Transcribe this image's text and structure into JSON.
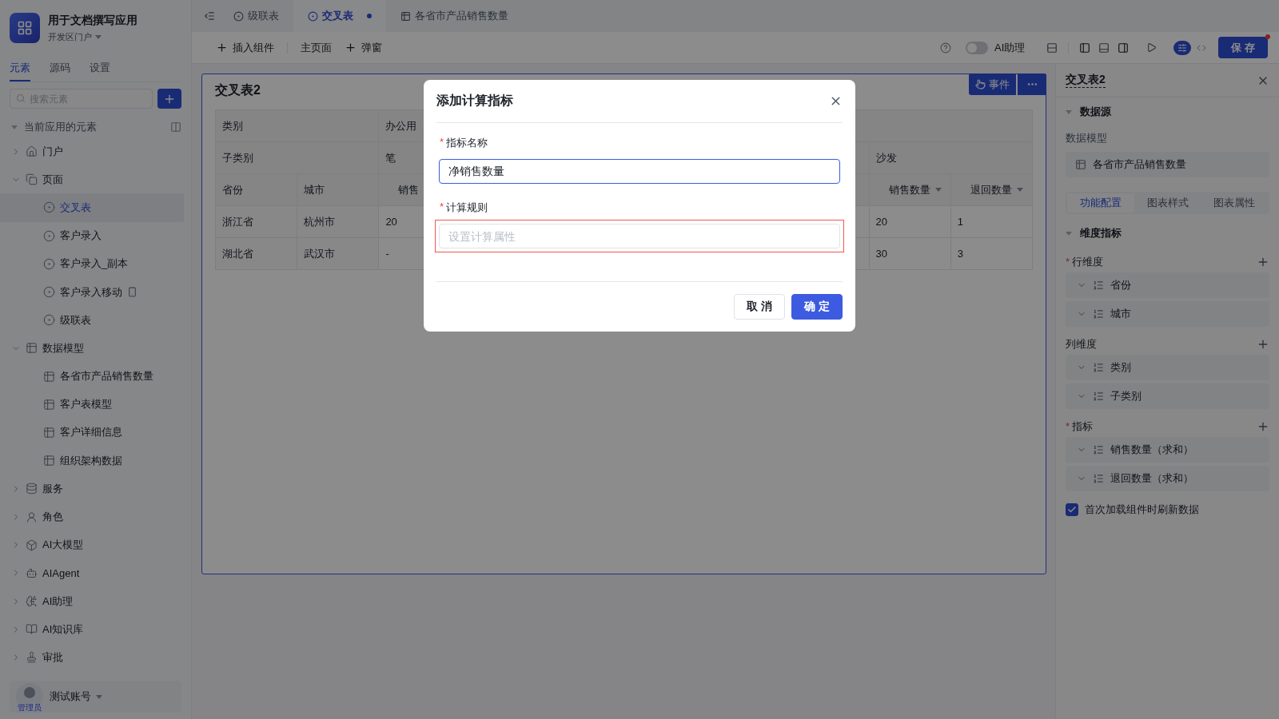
{
  "app": {
    "title": "用于文档撰写应用",
    "portal": "开发区门户"
  },
  "sidebar_tabs": [
    {
      "label": "元素",
      "selected": true
    },
    {
      "label": "源码",
      "selected": false
    },
    {
      "label": "设置",
      "selected": false
    }
  ],
  "search": {
    "placeholder": "搜索元素"
  },
  "tree": {
    "title": "当前应用的元素",
    "expanded": true,
    "items": [
      {
        "label": "门户",
        "kind": "home",
        "expanded": false
      },
      {
        "label": "页面",
        "kind": "pages",
        "expanded": true,
        "children": [
          {
            "label": "交叉表",
            "kind": "page",
            "selected": true
          },
          {
            "label": "客户录入",
            "kind": "page",
            "selected": false
          },
          {
            "label": "客户录入_副本",
            "kind": "page",
            "selected": false
          },
          {
            "label": "客户录入移动",
            "kind": "mobile_page",
            "selected": false
          },
          {
            "label": "级联表",
            "kind": "page",
            "selected": false
          }
        ]
      },
      {
        "label": "数据模型",
        "kind": "table",
        "expanded": true,
        "children": [
          {
            "label": "各省市产品销售数量",
            "kind": "table",
            "selected": false
          },
          {
            "label": "客户表模型",
            "kind": "table",
            "selected": false
          },
          {
            "label": "客户详细信息",
            "kind": "table",
            "selected": false
          },
          {
            "label": "组织架构数据",
            "kind": "table",
            "selected": false
          }
        ]
      },
      {
        "label": "服务",
        "kind": "service",
        "expanded": false
      },
      {
        "label": "角色",
        "kind": "role",
        "expanded": false
      },
      {
        "label": "AI大模型",
        "kind": "llm",
        "expanded": false
      },
      {
        "label": "AIAgent",
        "kind": "agent",
        "expanded": false
      },
      {
        "label": "AI助理",
        "kind": "assistant",
        "expanded": false
      },
      {
        "label": "AI知识库",
        "kind": "knowledge",
        "expanded": false
      },
      {
        "label": "审批",
        "kind": "approval",
        "expanded": false
      }
    ]
  },
  "user": {
    "name": "测试账号",
    "badge": "管理员"
  },
  "editor_tabs": [
    {
      "label": "级联表",
      "kind": "page",
      "selected": false,
      "modified": false
    },
    {
      "label": "交叉表",
      "kind": "page",
      "selected": true,
      "modified": true
    },
    {
      "label": "各省市产品销售数量",
      "kind": "table",
      "selected": false,
      "modified": false
    }
  ],
  "toolbar": {
    "left": [
      {
        "label": "插入组件",
        "kind": "add"
      },
      {
        "label": "主页面",
        "kind": "text"
      },
      {
        "label": "弹窗",
        "kind": "add"
      }
    ],
    "assistant": {
      "label": "AI助理",
      "on": false
    },
    "mode": [
      {
        "kind": "design",
        "selected": true
      },
      {
        "kind": "code",
        "selected": false
      }
    ],
    "save": {
      "label": "保 存",
      "unsaved": true
    }
  },
  "widget": {
    "title": "交叉表2",
    "event_button": "事件",
    "table": {
      "header_rows": [
        [
          {
            "text": "类别"
          },
          {
            "text": "办公用"
          },
          {}
        ],
        [
          {
            "text": "子类别"
          },
          {
            "text": "笔"
          },
          {},
          {},
          {
            "text": "沙发"
          }
        ],
        [
          {
            "text": "省份",
            "sortable": false
          },
          {
            "text": "城市",
            "sortable": false
          },
          {
            "text": "销售"
          },
          {},
          {},
          {},
          {},
          {},
          {
            "text": "销售数量",
            "sortable": true
          },
          {
            "text": "退回数量",
            "sortable": true
          }
        ]
      ],
      "rows": [
        [
          {
            "text": "浙江省"
          },
          {
            "text": "杭州市"
          },
          {
            "text": "20"
          },
          {},
          {},
          {},
          {},
          {},
          {
            "text": "20"
          },
          {
            "text": "1"
          }
        ],
        [
          {
            "text": "湖北省"
          },
          {
            "text": "武汉市"
          },
          {
            "text": "-"
          },
          {},
          {},
          {},
          {},
          {},
          {
            "text": "30"
          },
          {
            "text": "3"
          }
        ]
      ]
    }
  },
  "panel": {
    "title": "交叉表2",
    "datasource": {
      "title": "数据源",
      "expanded": true,
      "label": "数据模型",
      "model": "各省市产品销售数量"
    },
    "tabs": [
      {
        "label": "功能配置",
        "selected": true
      },
      {
        "label": "图表样式",
        "selected": false
      },
      {
        "label": "图表属性",
        "selected": false
      }
    ],
    "dimensions": {
      "title": "维度指标",
      "expanded": true,
      "groups": [
        {
          "label": "行维度",
          "required_mark": "*",
          "items": [
            "省份",
            "城市"
          ]
        },
        {
          "label": "列维度",
          "items": [
            "类别",
            "子类别"
          ]
        },
        {
          "label": "指标",
          "required_mark": "*",
          "items": [
            "销售数量（求和）",
            "退回数量（求和）"
          ]
        }
      ]
    },
    "refresh": {
      "label": "首次加载组件时刷新数据",
      "checked": true
    }
  },
  "dialog": {
    "title": "添加计算指标",
    "fields": [
      {
        "label": "指标名称",
        "required_mark": "*",
        "value": "净销售数量",
        "focused": true,
        "highlighted": false
      },
      {
        "label": "计算规则",
        "required_mark": "*",
        "placeholder": "设置计算属性",
        "focused": false,
        "highlighted": true
      }
    ],
    "buttons": [
      {
        "label": "取 消",
        "kind": "secondary"
      },
      {
        "label": "确 定",
        "kind": "primary"
      }
    ]
  }
}
